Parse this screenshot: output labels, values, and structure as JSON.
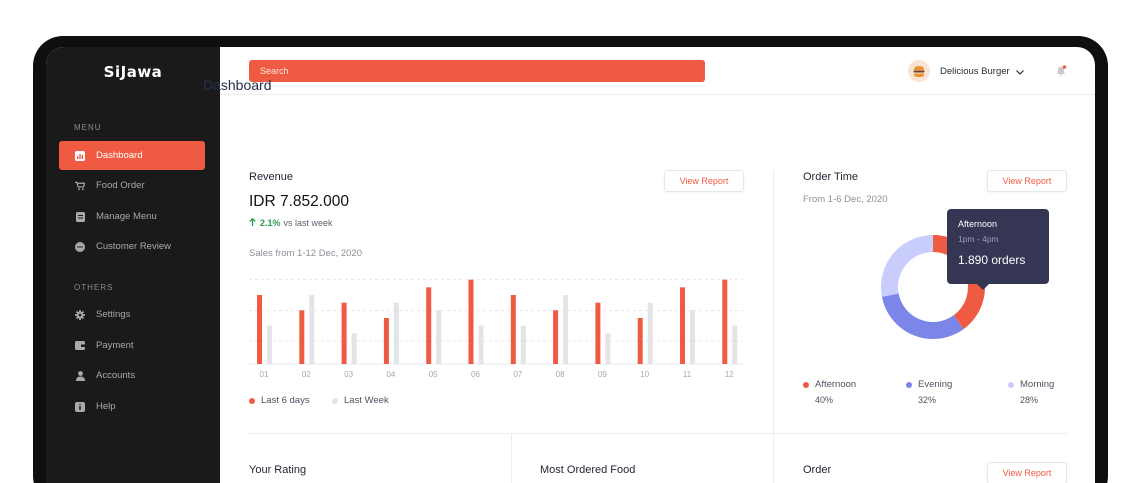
{
  "sidebar": {
    "brand": "SiJawa",
    "menu_label": "MENU",
    "others_label": "OTHERS",
    "menu_items": [
      {
        "label": "Dashboard",
        "icon": "chart-icon",
        "active": true
      },
      {
        "label": "Food Order",
        "icon": "cart-icon"
      },
      {
        "label": "Manage Menu",
        "icon": "document-icon"
      },
      {
        "label": "Customer Review",
        "icon": "chat-icon"
      }
    ],
    "other_items": [
      {
        "label": "Settings",
        "icon": "gear-icon"
      },
      {
        "label": "Payment",
        "icon": "wallet-icon"
      },
      {
        "label": "Accounts",
        "icon": "user-icon"
      },
      {
        "label": "Help",
        "icon": "info-icon"
      }
    ]
  },
  "header": {
    "search_placeholder": "Search",
    "user_name": "Delicious Burger"
  },
  "page_title": "Dashboard",
  "revenue": {
    "title": "Revenue",
    "button": "View Report",
    "value": "IDR 7.852.000",
    "change": "2.1%",
    "change_suffix": "vs last week",
    "subtitle": "Sales from 1-12 Dec, 2020",
    "legend_current": "Last 6 days",
    "legend_previous": "Last Week"
  },
  "order_time": {
    "title": "Order Time",
    "button": "View Report",
    "subtitle": "From 1-6 Dec, 2020",
    "tooltip": {
      "label": "Afternoon",
      "time": "1pm - 4pm",
      "value": "1.890 orders"
    },
    "segments": [
      {
        "label": "Afternoon",
        "pct_text": "40%"
      },
      {
        "label": "Evening",
        "pct_text": "32%"
      },
      {
        "label": "Morning",
        "pct_text": "28%"
      }
    ]
  },
  "bottom": {
    "rating_title": "Your Rating",
    "food_title": "Most Ordered Food",
    "order_title": "Order",
    "order_button": "View Report"
  },
  "colors": {
    "accent": "#ef5b42",
    "previous": "#e3e3e8",
    "evening": "#7b86e8",
    "morning": "#c9cdfb",
    "sidebar_bg": "#1a1a1b"
  },
  "chart_data": [
    {
      "type": "bar",
      "categories": [
        "01",
        "02",
        "03",
        "04",
        "05",
        "06",
        "07",
        "08",
        "09",
        "10",
        "11",
        "12"
      ],
      "series": [
        {
          "name": "Last 6 days",
          "values": [
            9,
            7,
            8,
            6,
            10,
            11,
            9,
            7,
            8,
            6,
            10,
            11
          ]
        },
        {
          "name": "Last Week",
          "values": [
            5,
            9,
            4,
            8,
            7,
            5,
            5,
            9,
            4,
            8,
            7,
            5
          ]
        }
      ],
      "ylim": [
        0,
        12
      ],
      "grid": true
    },
    {
      "type": "pie",
      "categories": [
        "Afternoon",
        "Evening",
        "Morning"
      ],
      "values": [
        40,
        32,
        28
      ]
    }
  ]
}
